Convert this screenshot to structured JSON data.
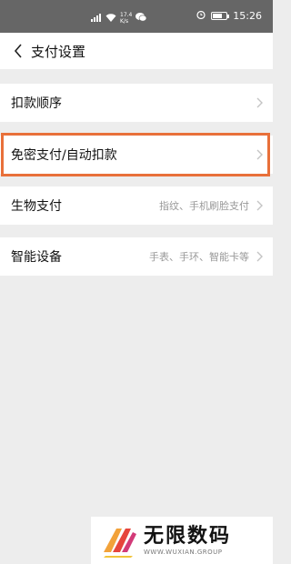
{
  "status_bar": {
    "speed_top": "17.4",
    "speed_bottom": "K/s",
    "time": "15:26",
    "icons": [
      "signal-icon",
      "wifi-icon",
      "wechat-icon",
      "alarm-icon",
      "battery-icon"
    ]
  },
  "header": {
    "back_icon": "chevron-left-icon",
    "title": "支付设置"
  },
  "rows": [
    {
      "label": "扣款顺序",
      "value": ""
    },
    {
      "label": "免密支付/自动扣款",
      "value": ""
    },
    {
      "label": "生物支付",
      "value": "指纹、手机刷脸支付"
    },
    {
      "label": "智能设备",
      "value": "手表、手环、智能卡等"
    }
  ],
  "highlight_color": "#e8703a",
  "watermark": {
    "title": "无限数码",
    "url": "WWW.WUXIAN.GROUP"
  }
}
